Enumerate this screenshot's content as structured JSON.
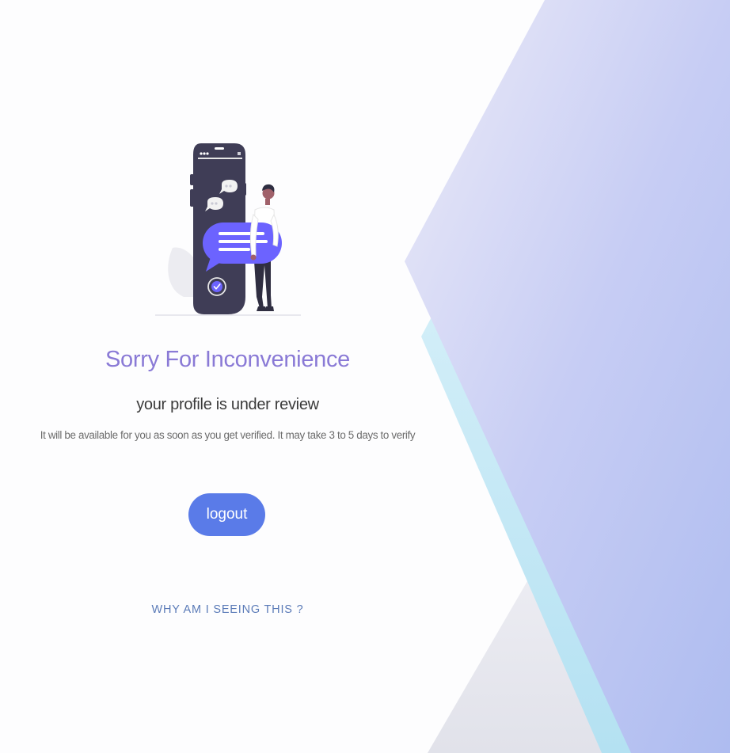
{
  "message": {
    "title": "Sorry For Inconvenience",
    "subtitle": "your profile is under review",
    "description": "It will be available for you as soon as you get verified. It may take 3 to 5 days to verify"
  },
  "actions": {
    "logout_label": "logout",
    "why_label": "WHY AM I SEEING THIS ?"
  },
  "colors": {
    "title": "#8a7ad6",
    "button": "#5a7be8",
    "link": "#5b7bb8",
    "illustration_phone": "#3f3d56",
    "illustration_bubble": "#6c63ff"
  },
  "icons": {
    "illustration": "person-with-phone-and-chat-illustration",
    "check": "check-circle-icon"
  }
}
